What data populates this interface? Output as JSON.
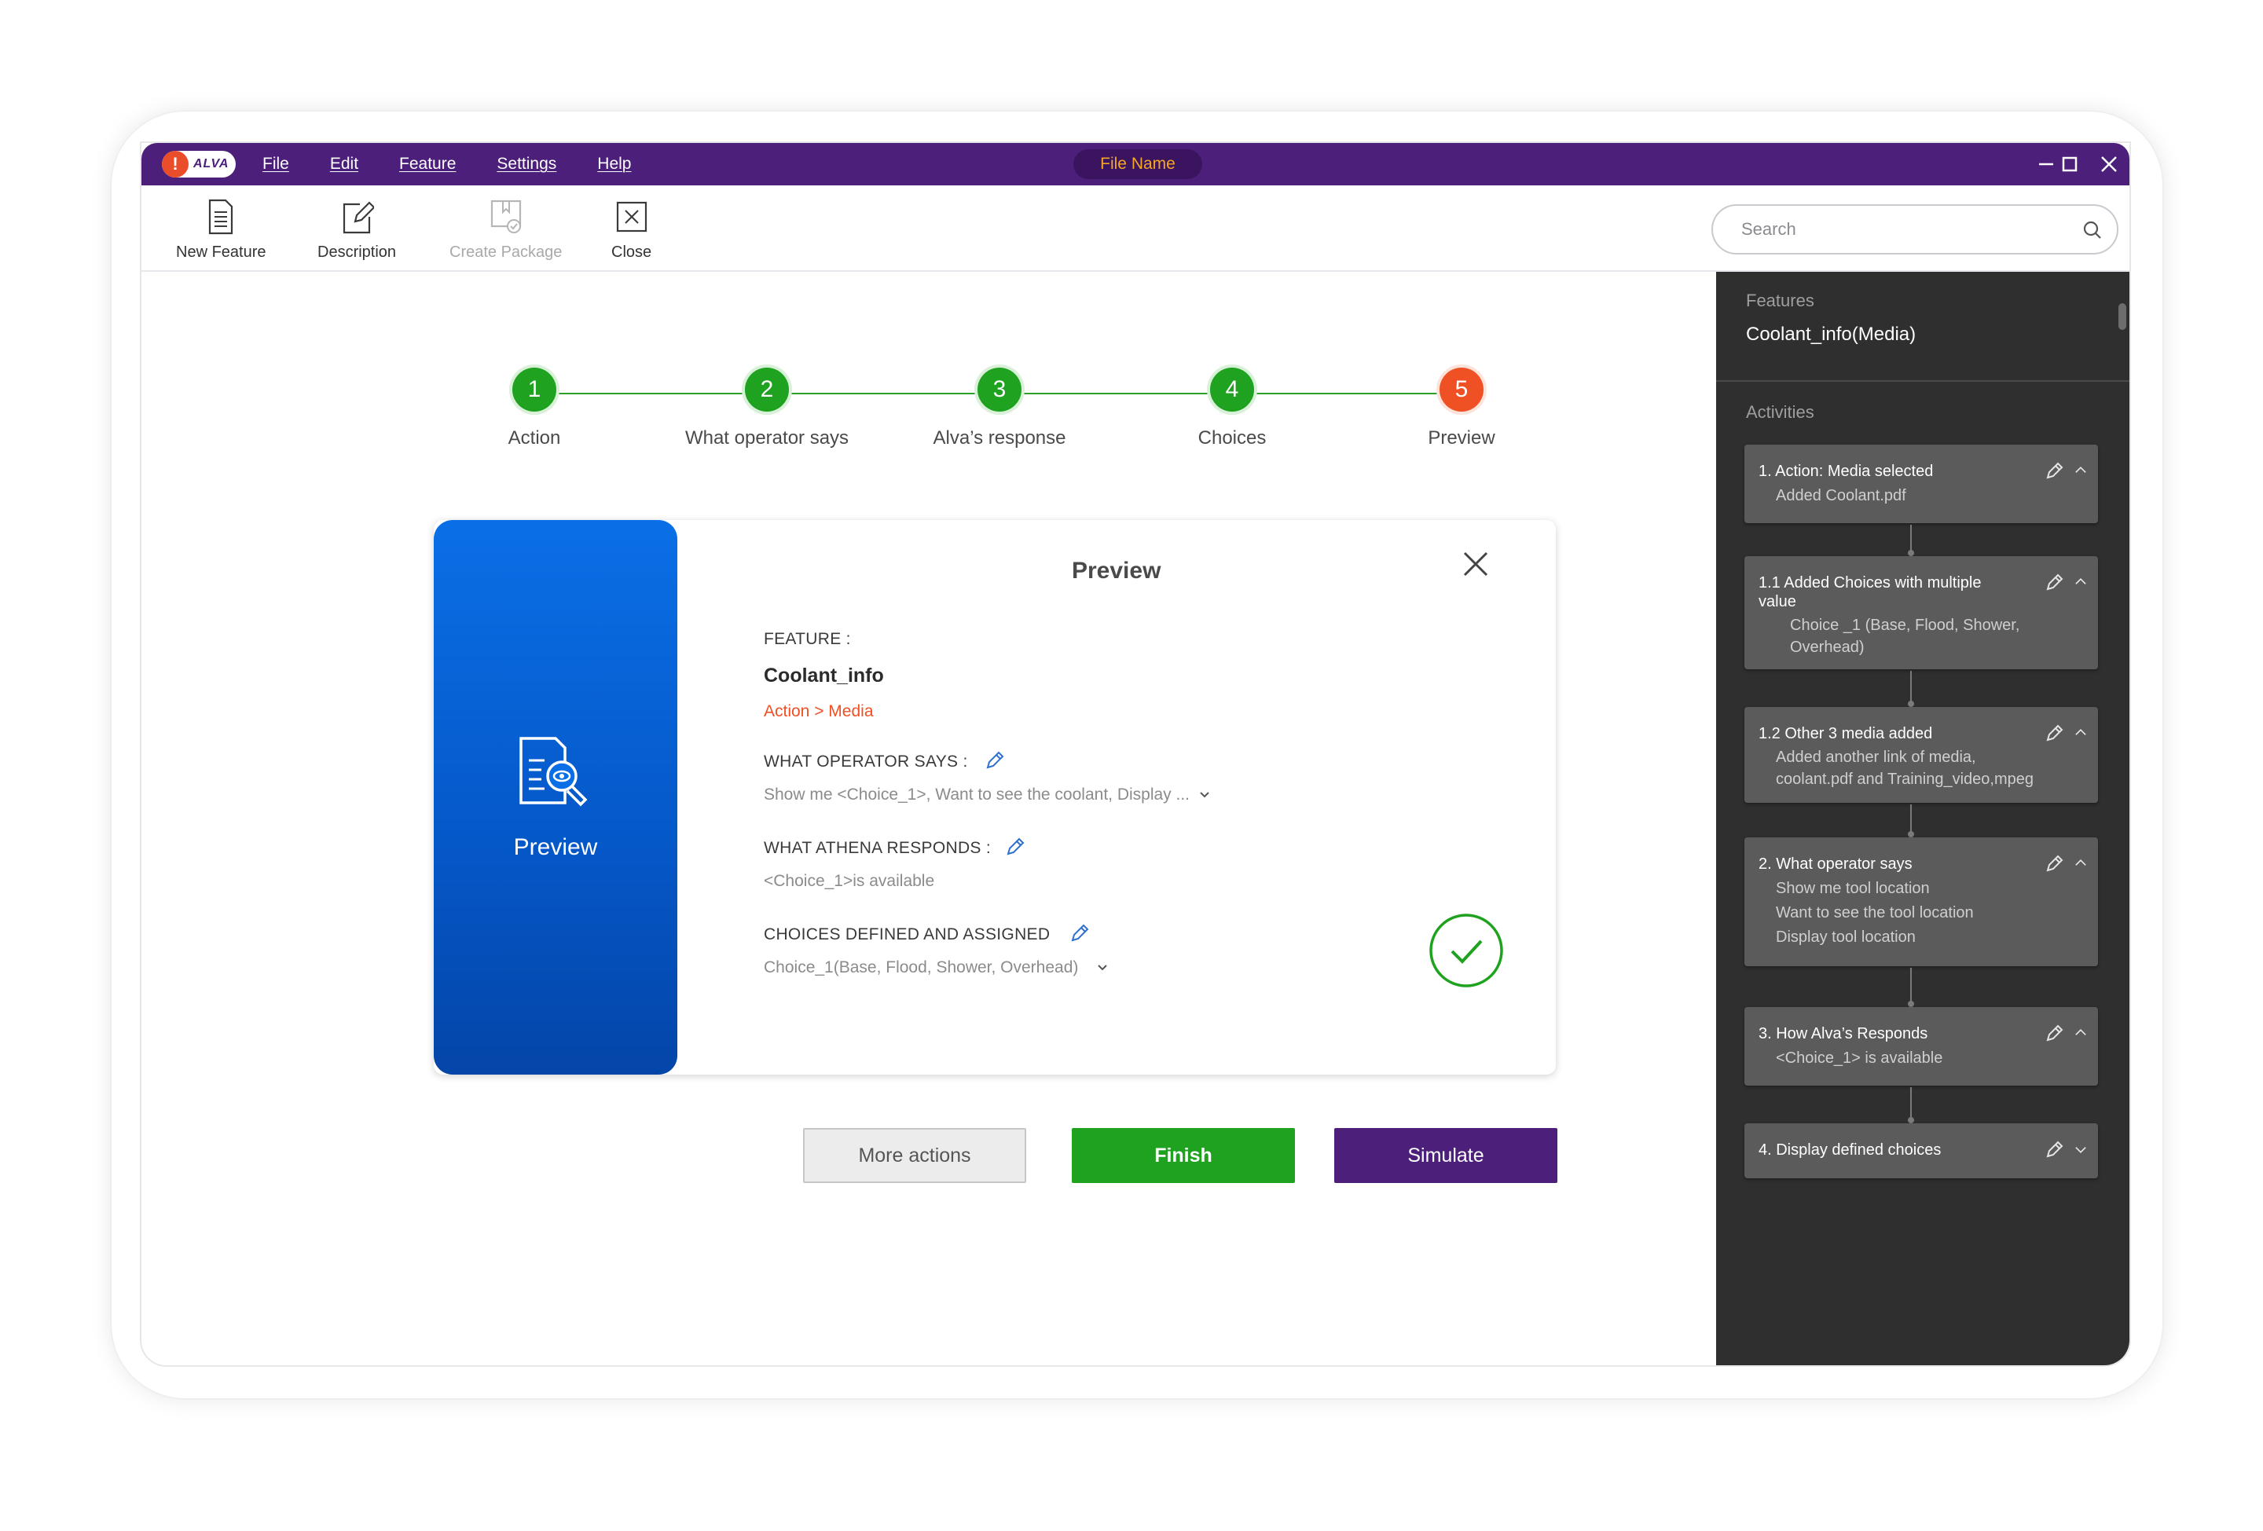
{
  "titlebar": {
    "logo_text": "ALVA",
    "menu": [
      "File",
      "Edit",
      "Feature",
      "Settings",
      "Help"
    ],
    "file_name": "File Name",
    "controls": {
      "minimize": "–",
      "maximize": "□",
      "close": "✕"
    }
  },
  "toolbar": {
    "new_feature": "New Feature",
    "description": "Description",
    "create_package": "Create Package",
    "close": "Close"
  },
  "search": {
    "placeholder": "Search"
  },
  "sidebar": {
    "features_label": "Features",
    "feature_name": "Coolant_info(Media)",
    "activities_label": "Activities",
    "cards": [
      {
        "title": "1. Action: Media selected",
        "body": "Added Coolant.pdf",
        "expanded": true
      },
      {
        "title": "1.1 Added Choices with multiple\n    value",
        "body": "Choice _1 (Base, Flood, Shower,\nOverhead)",
        "expanded": true
      },
      {
        "title": "1.2 Other 3 media added",
        "body": "Added another link of media,\ncoolant.pdf and Training_video,mpeg",
        "expanded": true
      },
      {
        "title": "2. What operator says",
        "body": "Show me tool location\nWant to see the tool location\nDisplay tool location",
        "expanded": true
      },
      {
        "title": "3. How Alva’s Responds",
        "body": "<Choice_1> is available",
        "expanded": true
      },
      {
        "title": "4. Display defined choices",
        "body": "",
        "expanded": false
      }
    ]
  },
  "stepper": {
    "steps": [
      {
        "number": "1",
        "label": "Action",
        "status": "done"
      },
      {
        "number": "2",
        "label": "What operator says",
        "status": "done"
      },
      {
        "number": "3",
        "label": "Alva’s response",
        "status": "done"
      },
      {
        "number": "4",
        "label": "Choices",
        "status": "done"
      },
      {
        "number": "5",
        "label": "Preview",
        "status": "active"
      }
    ],
    "colors": {
      "done": "#1fa21f",
      "active": "#ef5024"
    }
  },
  "preview": {
    "side_label": "Preview",
    "title": "Preview",
    "feature_label": "FEATURE :",
    "feature_name": "Coolant_info",
    "feature_path": "Action > Media",
    "operator_label": "WHAT OPERATOR SAYS :",
    "operator_value": "Show me <Choice_1>, Want to see the coolant, Display ...",
    "athena_label": "WHAT ATHENA  RESPONDS :",
    "athena_value": "<Choice_1>is available",
    "choices_label": "CHOICES DEFINED AND ASSIGNED",
    "choices_value": "Choice_1(Base, Flood, Shower, Overhead)"
  },
  "actions": {
    "more": "More actions",
    "finish": "Finish",
    "simulate": "Simulate"
  },
  "colors": {
    "brand_purple": "#4b1f7a",
    "success_green": "#1fa21f",
    "accent_orange": "#ef5024",
    "preview_blue": "#0a6fe6",
    "sidebar_bg": "#2f2f2f"
  }
}
